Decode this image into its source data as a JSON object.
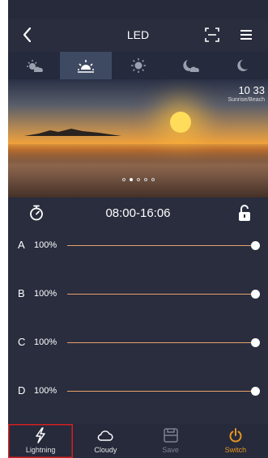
{
  "header": {
    "title": "LED"
  },
  "modes": [
    {
      "id": "mode-sunrise",
      "icon": "sunrise-cloudy-icon"
    },
    {
      "id": "mode-sun-up",
      "icon": "sunrise-icon",
      "active": true
    },
    {
      "id": "mode-noon",
      "icon": "sun-icon"
    },
    {
      "id": "mode-dusk",
      "icon": "moon-cloud-icon"
    },
    {
      "id": "mode-night",
      "icon": "moon-icon"
    }
  ],
  "scene": {
    "time": "10 33",
    "subtext": "Sunrise/Beach",
    "page_count": 5,
    "current_page": 2
  },
  "schedule": {
    "range": "08:00-16:06"
  },
  "channels": [
    {
      "letter": "A",
      "percent": "100%",
      "level": 1.0
    },
    {
      "letter": "B",
      "percent": "100%",
      "level": 1.0
    },
    {
      "letter": "C",
      "percent": "100%",
      "level": 1.0
    },
    {
      "letter": "D",
      "percent": "100%",
      "level": 1.0
    }
  ],
  "tabs": [
    {
      "label": "Lightning",
      "icon": "lightning-icon"
    },
    {
      "label": "Cloudy",
      "icon": "cloud-icon"
    },
    {
      "label": "Save",
      "icon": "save-icon"
    },
    {
      "label": "Switch",
      "icon": "power-icon"
    }
  ],
  "colors": {
    "background": "#292d3e",
    "accent": "#e9a06a",
    "power": "#e8951e",
    "selection": "#d32020"
  }
}
